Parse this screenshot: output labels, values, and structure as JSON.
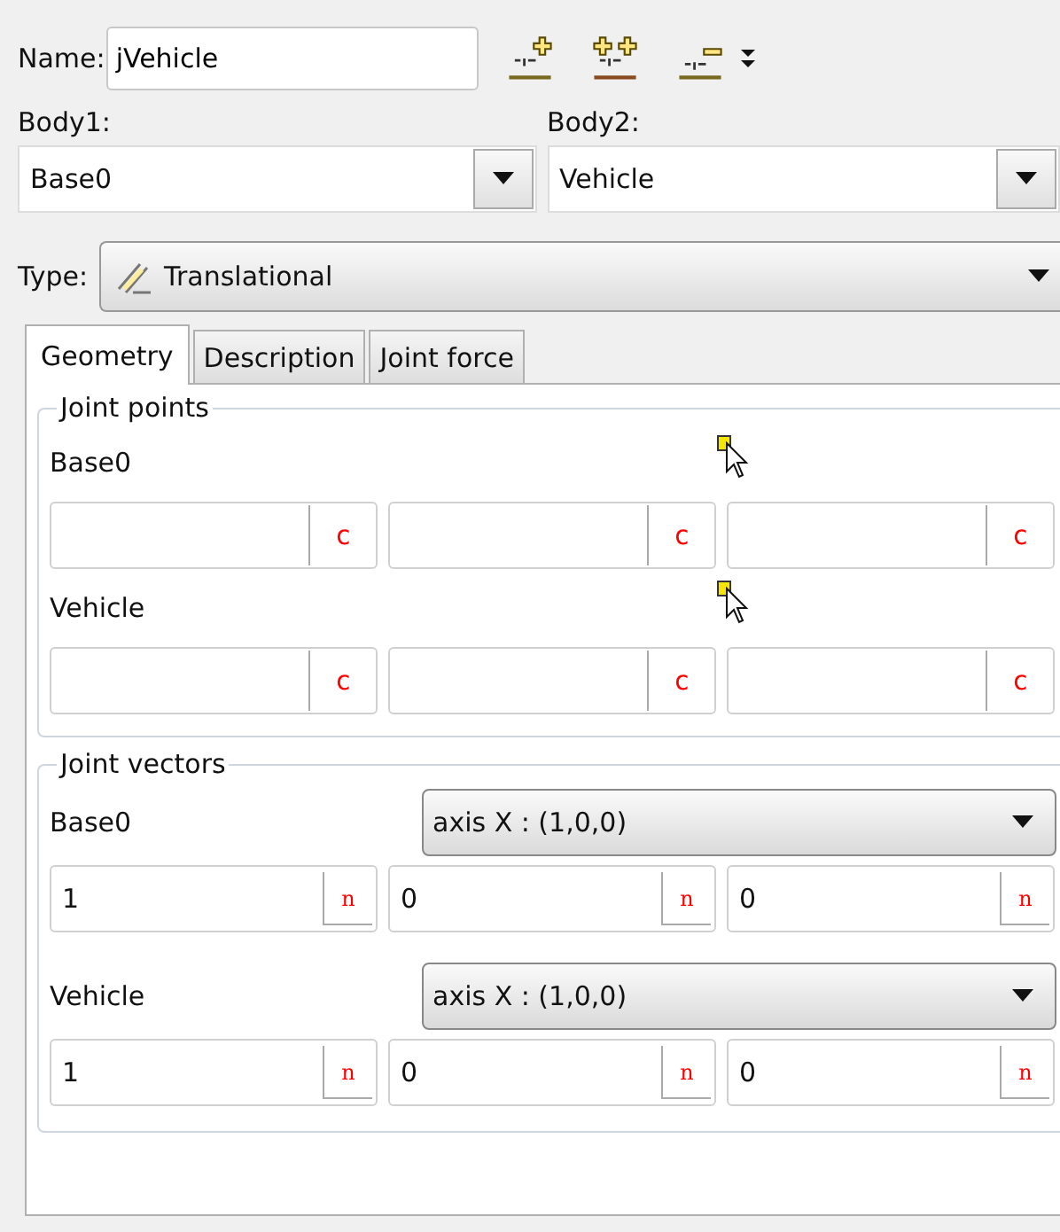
{
  "name_field": {
    "label": "Name:",
    "value": "jVehicle"
  },
  "bodies": [
    {
      "label": "Body1:",
      "value": "Base0"
    },
    {
      "label": "Body2:",
      "value": "Vehicle"
    }
  ],
  "type": {
    "label": "Type:",
    "value": "Translational"
  },
  "tabs": [
    {
      "label": "Geometry",
      "selected": true
    },
    {
      "label": "Description",
      "selected": false
    },
    {
      "label": "Joint force",
      "selected": false
    }
  ],
  "joint_points": {
    "title": "Joint points",
    "bodies": [
      {
        "name": "Base0",
        "fields": [
          {
            "button": "c"
          },
          {
            "button": "c"
          },
          {
            "button": "c"
          }
        ]
      },
      {
        "name": "Vehicle",
        "fields": [
          {
            "button": "c"
          },
          {
            "button": "c"
          },
          {
            "button": "c"
          }
        ]
      }
    ]
  },
  "joint_vectors": {
    "title": "Joint vectors",
    "bodies": [
      {
        "name": "Base0",
        "axis": "axis X : (1,0,0)",
        "fields": [
          {
            "value": "1",
            "button": "n"
          },
          {
            "value": "0",
            "button": "n"
          },
          {
            "value": "0",
            "button": "n"
          }
        ]
      },
      {
        "name": "Vehicle",
        "axis": "axis X : (1,0,0)",
        "fields": [
          {
            "value": "1",
            "button": "n"
          },
          {
            "value": "0",
            "button": "n"
          },
          {
            "value": "0",
            "button": "n"
          }
        ]
      }
    ]
  }
}
